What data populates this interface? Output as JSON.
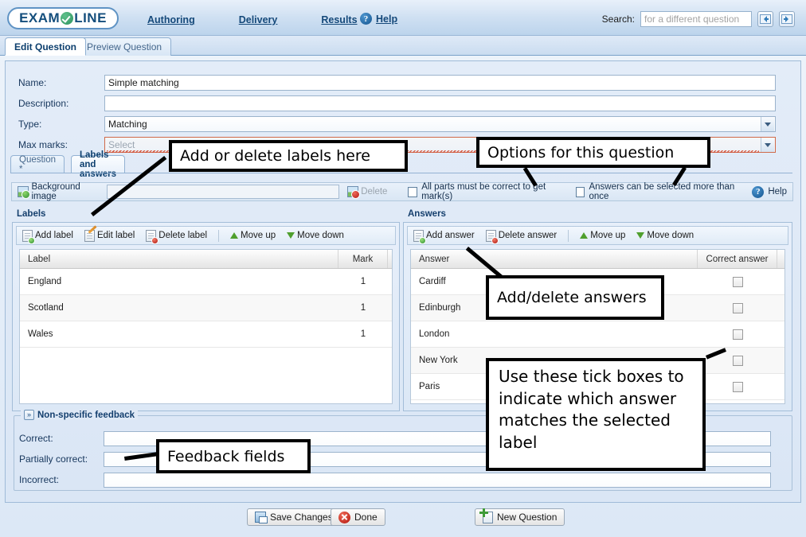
{
  "header": {
    "logo_text_left": "EXAM",
    "logo_text_right": "LINE",
    "logo_icon": "green-check-circle-icon",
    "nav": [
      {
        "label": "Authoring",
        "name": "nav-authoring"
      },
      {
        "label": "Delivery",
        "name": "nav-delivery"
      },
      {
        "label": "Results",
        "name": "nav-results"
      }
    ],
    "help_label": "Help",
    "help_icon": "question-mark-circle-icon",
    "search_label": "Search:",
    "search_placeholder": "for a different question",
    "search_value": "",
    "prev_button_icon": "arrow-left-icon",
    "next_button_icon": "arrow-right-icon"
  },
  "main_tabs": [
    {
      "label": "Edit Question",
      "active": true
    },
    {
      "label": "Preview Question",
      "active": false
    }
  ],
  "form": {
    "name_label": "Name:",
    "name_value": "Simple matching",
    "description_label": "Description:",
    "description_value": "",
    "type_label": "Type:",
    "type_value": "Matching",
    "maxmarks_label": "Max marks:",
    "maxmarks_value": "Select",
    "maxmarks_has_error": true
  },
  "sub_tabs": [
    {
      "label": "Question *",
      "active": false
    },
    {
      "label": "Labels and answers",
      "active": true
    }
  ],
  "options_bar": {
    "background_image_label": "Background image",
    "background_image_icon": "image-add-icon",
    "background_image_value": "",
    "delete_label": "Delete",
    "delete_icon": "image-delete-icon",
    "checkbox_all_parts": "All parts must be correct to get mark(s)",
    "checkbox_all_parts_checked": false,
    "checkbox_reuse_answers": "Answers can be selected more than once",
    "checkbox_reuse_answers_checked": false,
    "help_label": "Help",
    "help_icon": "question-mark-circle-icon"
  },
  "labels_panel": {
    "title": "Labels",
    "toolbar": [
      {
        "label": "Add label",
        "icon": "document-add-icon"
      },
      {
        "label": "Edit label",
        "icon": "document-edit-icon"
      },
      {
        "label": "Delete label",
        "icon": "document-delete-icon"
      },
      {
        "label": "Move up",
        "icon": "arrow-up-icon"
      },
      {
        "label": "Move down",
        "icon": "arrow-down-icon"
      }
    ],
    "columns": [
      "Label",
      "Mark"
    ],
    "rows": [
      {
        "label": "England",
        "mark": "1"
      },
      {
        "label": "Scotland",
        "mark": "1"
      },
      {
        "label": "Wales",
        "mark": "1"
      }
    ]
  },
  "answers_panel": {
    "title": "Answers",
    "toolbar": [
      {
        "label": "Add answer",
        "icon": "document-add-icon"
      },
      {
        "label": "Delete answer",
        "icon": "document-delete-icon"
      },
      {
        "label": "Move up",
        "icon": "arrow-up-icon"
      },
      {
        "label": "Move down",
        "icon": "arrow-down-icon"
      }
    ],
    "columns": [
      "Answer",
      "Correct answer"
    ],
    "rows": [
      {
        "answer": "Cardiff",
        "correct": false
      },
      {
        "answer": "Edinburgh",
        "correct": false
      },
      {
        "answer": "London",
        "correct": false
      },
      {
        "answer": "New York",
        "correct": false
      },
      {
        "answer": "Paris",
        "correct": false
      }
    ]
  },
  "feedback": {
    "legend": "Non-specific feedback",
    "toggle_icon": "chevron-double-down-icon",
    "rows": [
      {
        "label": "Correct:",
        "value": ""
      },
      {
        "label": "Partially correct:",
        "value": ""
      },
      {
        "label": "Incorrect:",
        "value": ""
      }
    ]
  },
  "buttons": {
    "save": {
      "label": "Save Changes",
      "icon": "save-disk-icon"
    },
    "done": {
      "label": "Done",
      "icon": "red-x-circle-icon"
    },
    "new_question": {
      "label": "New Question",
      "icon": "new-document-icon"
    }
  },
  "annotations": [
    {
      "text": "Add or delete labels here",
      "name": "annotation-add-delete-labels"
    },
    {
      "text": "Options for this question",
      "name": "annotation-options-for-question"
    },
    {
      "text": "Add/delete answers",
      "name": "annotation-add-delete-answers"
    },
    {
      "text": "Use these tick boxes to indicate which answer matches the selected label",
      "name": "annotation-tick-boxes"
    },
    {
      "text": "Feedback fields",
      "name": "annotation-feedback-fields"
    }
  ],
  "colors": {
    "brand_blue": "#15497a",
    "brand_green": "#2e9460",
    "panel_bg": "#dce8f6",
    "error_red": "#d24b33"
  }
}
